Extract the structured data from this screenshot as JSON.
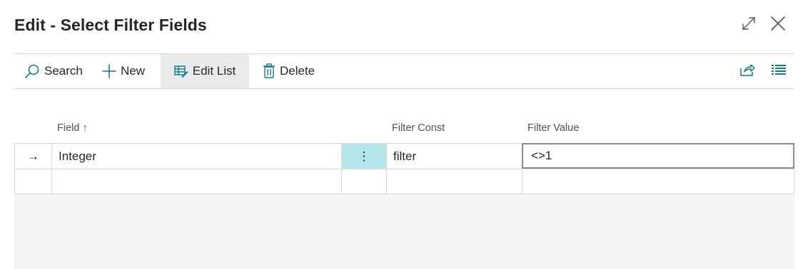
{
  "dialog": {
    "title": "Edit - Select Filter Fields"
  },
  "window_controls": {
    "expand_icon": "expand-icon",
    "close_icon": "close-icon"
  },
  "toolbar": {
    "search_label": "Search",
    "new_label": "New",
    "edit_list_label": "Edit List",
    "delete_label": "Delete",
    "share_icon": "share-icon",
    "list_view_icon": "list-view-icon"
  },
  "grid": {
    "columns": {
      "field": "Field",
      "field_sort_indicator": "↑",
      "filter_const": "Filter Const",
      "filter_value": "Filter Value"
    },
    "rows": [
      {
        "indicator": "→",
        "field": "Integer",
        "menu": "⋮",
        "filter_const": "filter",
        "filter_value": "<>1"
      },
      {
        "indicator": "",
        "field": "",
        "menu": "",
        "filter_const": "",
        "filter_value": ""
      }
    ]
  },
  "colors": {
    "accent": "#0f7b83",
    "selected_menu_cell": "#b2e6ea",
    "active_button_bg": "#e9eaec",
    "empty_area_bg": "#f4f5f7"
  }
}
